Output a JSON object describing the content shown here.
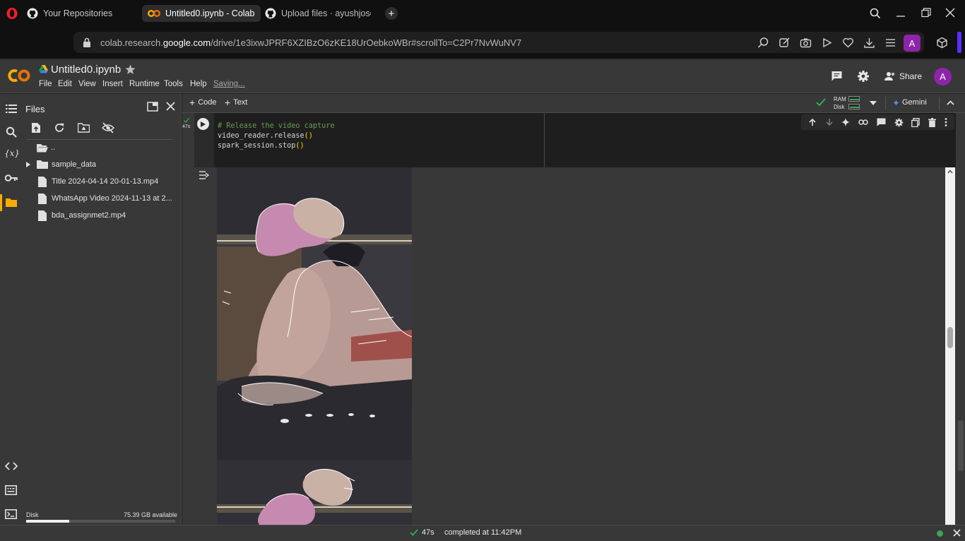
{
  "browser": {
    "tabs": [
      {
        "label": "Your Repositories",
        "icon": "github-icon"
      },
      {
        "label": "Untitled0.ipynb - Colab",
        "icon": "colab-icon",
        "active": true
      },
      {
        "label": "Upload files · ayushjoseph",
        "icon": "github-icon"
      }
    ],
    "url_prefix": "colab.research.",
    "url_domain": "google.com",
    "url_path": "/drive/1e3ixwJPRF6XZIBzO6zKE18UrOebkoWBr#scrollTo=C2Pr7NvWuNV7",
    "profile_initial": "A"
  },
  "colab": {
    "logo": "CO",
    "notebook_title": "Untitled0.ipynb",
    "menu": [
      "File",
      "Edit",
      "View",
      "Insert",
      "Runtime",
      "Tools",
      "Help"
    ],
    "saving_status": "Saving...",
    "share_label": "Share",
    "avatar_initial": "A"
  },
  "files_panel": {
    "title": "Files",
    "items": [
      {
        "name": "..",
        "type": "folder-open"
      },
      {
        "name": "sample_data",
        "type": "folder"
      },
      {
        "name": "Title 2024-04-14 20-01-13.mp4",
        "type": "file"
      },
      {
        "name": "WhatsApp Video 2024-11-13 at 2...",
        "type": "file"
      },
      {
        "name": "bda_assignmet2.mp4",
        "type": "file"
      }
    ],
    "disk_label": "Disk",
    "disk_available": "75.39 GB available",
    "disk_used_fraction": 0.29
  },
  "toolbar": {
    "code_label": "Code",
    "text_label": "Text",
    "ram_label": "RAM",
    "disk_label": "Disk",
    "gemini_label": "Gemini"
  },
  "cell": {
    "exec_time": "47s",
    "code_lines": [
      {
        "comment": "# Release the video capture"
      },
      {
        "text": "video_reader.release",
        "paren": "()"
      },
      {
        "text": "spark_session.stop",
        "paren": "()"
      }
    ]
  },
  "status": {
    "time": "47s",
    "message": "completed at 11:42PM"
  },
  "colors": {
    "accent_orange": "#f9ab00",
    "code_comment": "#6a9955",
    "paren": "#ffd700",
    "check_green": "#34a853",
    "avatar_purple": "#8e24aa"
  }
}
